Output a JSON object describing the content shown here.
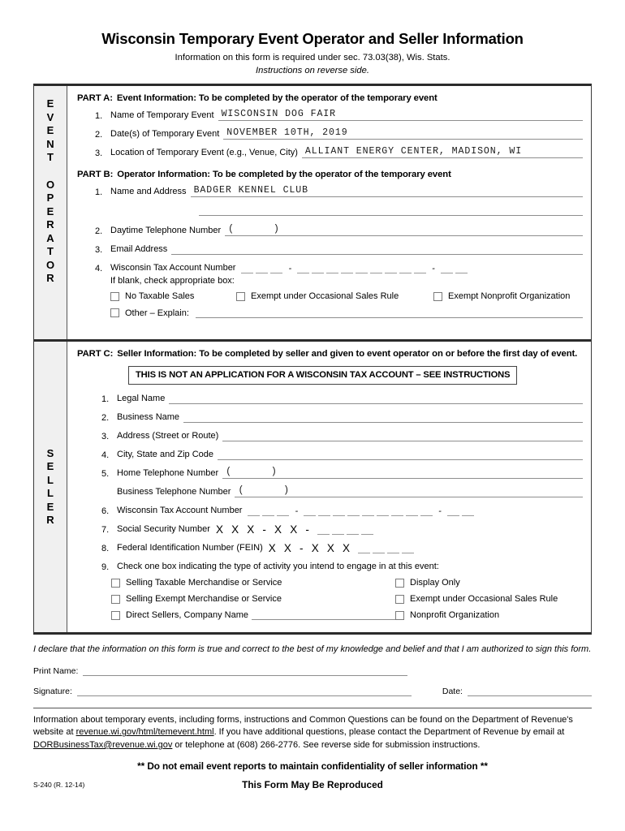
{
  "header": {
    "title": "Wisconsin Temporary Event Operator and Seller Information",
    "subtitle": "Information on this form is required under sec. 73.03(38), Wis. Stats.",
    "instructions": "Instructions on reverse side."
  },
  "sidebar": {
    "operator_line1": "EVENT",
    "operator_line2": "OPERATOR",
    "seller": "SELLER"
  },
  "part_a": {
    "label": "PART A:",
    "heading": "Event Information:  To be completed by the operator of the temporary event",
    "fields": [
      {
        "num": "1.",
        "label": "Name of Temporary Event",
        "value": "WISCONSIN DOG FAIR"
      },
      {
        "num": "2.",
        "label": "Date(s) of Temporary Event",
        "value": "NOVEMBER 10TH, 2019"
      },
      {
        "num": "3.",
        "label": "Location of Temporary Event (e.g., Venue, City)",
        "value": "ALLIANT ENERGY CENTER, MADISON, WI"
      }
    ]
  },
  "part_b": {
    "label": "PART B:",
    "heading": "Operator Information:  To be completed by the operator of the temporary event",
    "name_address": {
      "num": "1.",
      "label": "Name and Address",
      "value": "BADGER KENNEL CLUB"
    },
    "phone": {
      "num": "2.",
      "label": "Daytime Telephone Number",
      "value": ""
    },
    "email": {
      "num": "3.",
      "label": "Email Address",
      "value": ""
    },
    "tax_account": {
      "num": "4.",
      "label": "Wisconsin Tax Account Number"
    },
    "if_blank_note": "If blank, check appropriate box:",
    "checkboxes": [
      {
        "label": "No Taxable Sales",
        "checked": false
      },
      {
        "label": "Exempt under Occasional Sales Rule",
        "checked": false
      },
      {
        "label": "Exempt Nonprofit Organization",
        "checked": false
      }
    ],
    "other_checkbox": {
      "label": "Other – Explain:",
      "checked": false
    }
  },
  "part_c": {
    "label": "PART C:",
    "heading": "Seller Information:  To be completed by seller and given to event operator on or before the first day of event.",
    "warning": "THIS IS NOT AN APPLICATION FOR A WISCONSIN TAX ACCOUNT – SEE INSTRUCTIONS",
    "fields": [
      {
        "num": "1.",
        "label": "Legal Name",
        "value": ""
      },
      {
        "num": "2.",
        "label": "Business Name",
        "value": ""
      },
      {
        "num": "3.",
        "label": "Address (Street or Route)",
        "value": ""
      },
      {
        "num": "4.",
        "label": "City, State and Zip Code",
        "value": ""
      }
    ],
    "home_phone": {
      "num": "5.",
      "label": "Home Telephone Number",
      "value": ""
    },
    "business_phone": {
      "label": "Business Telephone Number",
      "value": ""
    },
    "tax_account": {
      "num": "6.",
      "label": "Wisconsin Tax Account Number"
    },
    "ssn": {
      "num": "7.",
      "label": "Social Security Number",
      "mask": "X X X - X X -"
    },
    "fein": {
      "num": "8.",
      "label": "Federal Identification Number (FEIN)",
      "mask": "X X - X X X"
    },
    "activity": {
      "num": "9.",
      "label": "Check one box indicating the type of activity you intend to engage in at this event:",
      "left": [
        {
          "label": "Selling Taxable Merchandise or Service",
          "checked": false
        },
        {
          "label": "Selling Exempt Merchandise or Service",
          "checked": false
        },
        {
          "label": "Direct Sellers, Company Name",
          "checked": false,
          "has_fill": true
        }
      ],
      "right": [
        {
          "label": "Display Only",
          "checked": false
        },
        {
          "label": "Exempt under Occasional Sales Rule",
          "checked": false
        },
        {
          "label": "Nonprofit Organization",
          "checked": false
        }
      ]
    }
  },
  "declaration": {
    "text": "I declare that the information on this form is true and correct to the best of my knowledge and belief and that I am authorized to sign this form.",
    "print_name_label": "Print Name:",
    "print_name_value": "",
    "signature_label": "Signature:",
    "signature_value": "",
    "date_label": "Date:",
    "date_value": ""
  },
  "footer": {
    "info_1": "Information about temporary events, including forms, instructions and Common Questions can be found on the Department of Revenue's website at ",
    "link_website": "revenue.wi.gov/html/temevent.html",
    "info_2": ".  If you have additional questions, please contact the Department of Revenue by email at ",
    "link_email": "DORBusinessTax@revenue.wi.gov",
    "info_3": " or telephone at (608) 266-2776.  See reverse side for submission instructions.",
    "notice": "**  Do not email event reports to maintain confidentiality of seller information  **",
    "form_number": "S-240 (R. 12-14)",
    "reproduce": "This Form May Be Reproduced"
  }
}
